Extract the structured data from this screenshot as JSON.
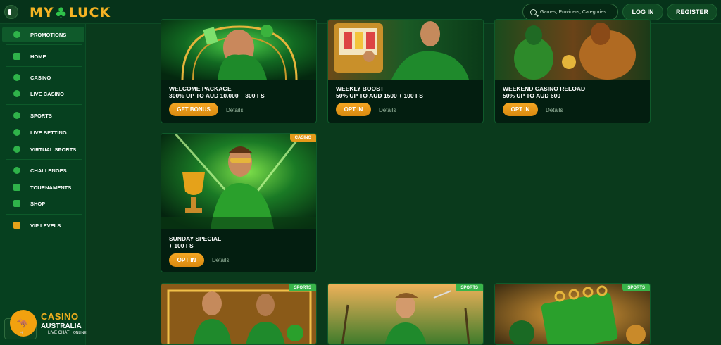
{
  "header": {
    "logo_left": "MY",
    "logo_right": "LUCK",
    "search_placeholder": "Games, Providers, Categories",
    "login_label": "LOG IN",
    "register_label": "REGISTER"
  },
  "sidebar": {
    "items": [
      {
        "label": "PROMOTIONS",
        "icon": "flame-icon"
      },
      {
        "label": "HOME",
        "icon": "home-icon"
      },
      {
        "label": "CASINO",
        "icon": "clover-icon"
      },
      {
        "label": "LIVE CASINO",
        "icon": "live-casino-icon"
      },
      {
        "label": "SPORTS",
        "icon": "ball-icon"
      },
      {
        "label": "LIVE BETTING",
        "icon": "signal-icon"
      },
      {
        "label": "VIRTUAL SPORTS",
        "icon": "virtual-sports-icon"
      },
      {
        "label": "CHALLENGES",
        "icon": "challenge-icon"
      },
      {
        "label": "TOURNAMENTS",
        "icon": "podium-icon"
      },
      {
        "label": "SHOP",
        "icon": "shop-icon"
      },
      {
        "label": "VIP LEVELS",
        "icon": "vip-icon"
      }
    ]
  },
  "badge": {
    "casino": "CASINO",
    "australia": "AUSTRALIA",
    "live_chat": "LIVE CHAT",
    "online": "ONLINE",
    "partial": "H"
  },
  "promotions": [
    {
      "title_line1": "WELCOME PACKAGE",
      "title_line2": "300% UP TO AUD 10.000 + 300 FS",
      "button": "GET BONUS",
      "details": "Details"
    },
    {
      "title_line1": "WEEKLY BOOST",
      "title_line2": "50% UP TO AUD 1500 + 100 FS",
      "button": "OPT IN",
      "details": "Details"
    },
    {
      "title_line1": "WEEKEND CASINO RELOAD",
      "title_line2": "50% UP TO AUD 600",
      "button": "OPT IN",
      "details": "Details"
    },
    {
      "tag": "CASINO",
      "title_line1": "SUNDAY SPECIAL",
      "title_line2": "+ 100 FS",
      "button": "OPT IN",
      "details": "Details"
    },
    {
      "tag": "SPORTS"
    },
    {
      "tag": "SPORTS"
    },
    {
      "tag": "SPORTS"
    }
  ],
  "colors": {
    "accent": "#f5a623",
    "brand_green": "#2fb34a",
    "background": "#0a3a1c"
  }
}
